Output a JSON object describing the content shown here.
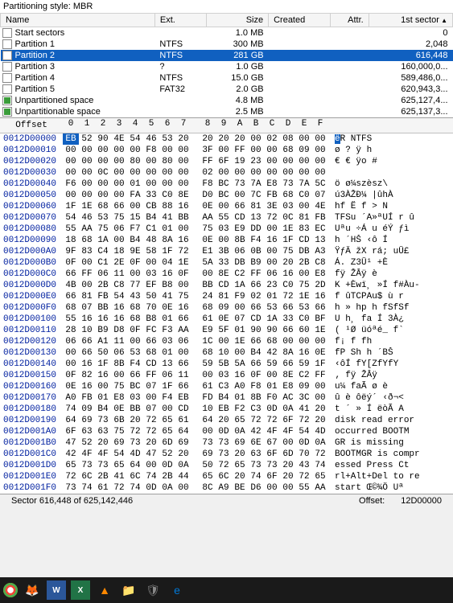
{
  "partitionStyleLabel": "Partitioning style: MBR",
  "columns": {
    "name": "Name",
    "ext": "Ext.",
    "size": "Size",
    "created": "Created",
    "attr": "Attr.",
    "firstSector": "1st sector"
  },
  "partitions": [
    {
      "name": "Start sectors",
      "ext": "",
      "size": "1.0 MB",
      "created": "",
      "attr": "",
      "first": "0",
      "icon": "plain"
    },
    {
      "name": "Partition 1",
      "ext": "NTFS",
      "size": "300 MB",
      "created": "",
      "attr": "",
      "first": "2,048",
      "icon": "plain"
    },
    {
      "name": "Partition 2",
      "ext": "NTFS",
      "size": "281 GB",
      "created": "",
      "attr": "",
      "first": "616,448",
      "icon": "plain",
      "selected": true
    },
    {
      "name": "Partition 3",
      "ext": "?",
      "size": "1.0 GB",
      "created": "",
      "attr": "",
      "first": "160,000,0...",
      "icon": "plain"
    },
    {
      "name": "Partition 4",
      "ext": "NTFS",
      "size": "15.0 GB",
      "created": "",
      "attr": "",
      "first": "589,486,0...",
      "icon": "plain"
    },
    {
      "name": "Partition 5",
      "ext": "FAT32",
      "size": "2.0 GB",
      "created": "",
      "attr": "",
      "first": "620,943,3...",
      "icon": "plain"
    },
    {
      "name": "Unpartitioned space",
      "ext": "",
      "size": "4.8 MB",
      "created": "",
      "attr": "",
      "first": "625,127,4...",
      "icon": "green"
    },
    {
      "name": "Unpartitionable space",
      "ext": "",
      "size": "2.5 MB",
      "created": "",
      "attr": "",
      "first": "625,137,3...",
      "icon": "green"
    }
  ],
  "hexHeader": {
    "offset": "Offset",
    "cols": [
      "0",
      "1",
      "2",
      "3",
      "4",
      "5",
      "6",
      "7",
      "8",
      "9",
      "A",
      "B",
      "C",
      "D",
      "E",
      "F"
    ]
  },
  "hexRows": [
    {
      "off": "0012D00000",
      "b": [
        "EB",
        "52",
        "90",
        "4E",
        "54",
        "46",
        "53",
        "20",
        "20",
        "20",
        "20",
        "00",
        "02",
        "08",
        "00",
        "00"
      ],
      "a": "ëR NTFS         ",
      "sel": 0
    },
    {
      "off": "0012D00010",
      "b": [
        "00",
        "00",
        "00",
        "00",
        "00",
        "F8",
        "00",
        "00",
        "3F",
        "00",
        "FF",
        "00",
        "00",
        "68",
        "09",
        "00"
      ],
      "a": "     ø  ? ÿ  h  "
    },
    {
      "off": "0012D00020",
      "b": [
        "00",
        "00",
        "00",
        "00",
        "80",
        "00",
        "80",
        "00",
        "FF",
        "6F",
        "19",
        "23",
        "00",
        "00",
        "00",
        "00"
      ],
      "a": "    €  € ÿo #    "
    },
    {
      "off": "0012D00030",
      "b": [
        "00",
        "00",
        "0C",
        "00",
        "00",
        "00",
        "00",
        "00",
        "02",
        "00",
        "00",
        "00",
        "00",
        "00",
        "00",
        "00"
      ],
      "a": "                "
    },
    {
      "off": "0012D00040",
      "b": [
        "F6",
        "00",
        "00",
        "00",
        "01",
        "00",
        "00",
        "00",
        "F8",
        "BC",
        "73",
        "7A",
        "E8",
        "73",
        "7A",
        "5C"
      ],
      "a": "ö       ø¼szèsz\\"
    },
    {
      "off": "0012D00050",
      "b": [
        "00",
        "00",
        "00",
        "00",
        "FA",
        "33",
        "C0",
        "8E",
        "D0",
        "BC",
        "00",
        "7C",
        "FB",
        "68",
        "C0",
        "07"
      ],
      "a": "    ú3ÀŽĐ¼ |ûhÀ "
    },
    {
      "off": "0012D00060",
      "b": [
        "1F",
        "1E",
        "68",
        "66",
        "00",
        "CB",
        "88",
        "16",
        "0E",
        "00",
        "66",
        "81",
        "3E",
        "03",
        "00",
        "4E"
      ],
      "a": "  hf Ë    f > N"
    },
    {
      "off": "0012D00070",
      "b": [
        "54",
        "46",
        "53",
        "75",
        "15",
        "B4",
        "41",
        "BB",
        "AA",
        "55",
        "CD",
        "13",
        "72",
        "0C",
        "81",
        "FB"
      ],
      "a": "TFSu ´A»ªUÍ r  û"
    },
    {
      "off": "0012D00080",
      "b": [
        "55",
        "AA",
        "75",
        "06",
        "F7",
        "C1",
        "01",
        "00",
        "75",
        "03",
        "E9",
        "DD",
        "00",
        "1E",
        "83",
        "EC"
      ],
      "a": "Uªu ÷Á  u éÝ  ƒì"
    },
    {
      "off": "0012D00090",
      "b": [
        "18",
        "68",
        "1A",
        "00",
        "B4",
        "48",
        "8A",
        "16",
        "0E",
        "00",
        "8B",
        "F4",
        "16",
        "1F",
        "CD",
        "13"
      ],
      "a": " h  ´HŠ   ‹ô  Í "
    },
    {
      "off": "0012D000A0",
      "b": [
        "9F",
        "83",
        "C4",
        "18",
        "9E",
        "58",
        "1F",
        "72",
        "E1",
        "3B",
        "06",
        "0B",
        "00",
        "75",
        "DB",
        "A3"
      ],
      "a": "ŸƒÄ žX rá;   uÛ£"
    },
    {
      "off": "0012D000B0",
      "b": [
        "0F",
        "00",
        "C1",
        "2E",
        "0F",
        "00",
        "04",
        "1E",
        "5A",
        "33",
        "DB",
        "B9",
        "00",
        "20",
        "2B",
        "C8"
      ],
      "a": "  Á.    Z3Û¹  +È"
    },
    {
      "off": "0012D000C0",
      "b": [
        "66",
        "FF",
        "06",
        "11",
        "00",
        "03",
        "16",
        "0F",
        "00",
        "8E",
        "C2",
        "FF",
        "06",
        "16",
        "00",
        "E8"
      ],
      "a": "fÿ      ŽÂÿ    è"
    },
    {
      "off": "0012D000D0",
      "b": [
        "4B",
        "00",
        "2B",
        "C8",
        "77",
        "EF",
        "B8",
        "00",
        "BB",
        "CD",
        "1A",
        "66",
        "23",
        "C0",
        "75",
        "2D"
      ],
      "a": "K +Èwï¸ »Í f#Àu-"
    },
    {
      "off": "0012D000E0",
      "b": [
        "66",
        "81",
        "FB",
        "54",
        "43",
        "50",
        "41",
        "75",
        "24",
        "81",
        "F9",
        "02",
        "01",
        "72",
        "1E",
        "16"
      ],
      "a": "f ûTCPAu$ ù  r  "
    },
    {
      "off": "0012D000F0",
      "b": [
        "68",
        "07",
        "BB",
        "16",
        "68",
        "70",
        "0E",
        "16",
        "68",
        "09",
        "00",
        "66",
        "53",
        "66",
        "53",
        "66"
      ],
      "a": "h » hp  h  fSfSf"
    },
    {
      "off": "0012D00100",
      "b": [
        "55",
        "16",
        "16",
        "16",
        "68",
        "B8",
        "01",
        "66",
        "61",
        "0E",
        "07",
        "CD",
        "1A",
        "33",
        "C0",
        "BF"
      ],
      "a": "U   h¸ fa  Í 3À¿"
    },
    {
      "off": "0012D00110",
      "b": [
        "28",
        "10",
        "B9",
        "D8",
        "0F",
        "FC",
        "F3",
        "AA",
        "E9",
        "5F",
        "01",
        "90",
        "90",
        "66",
        "60",
        "1E"
      ],
      "a": "( ¹Ø üóªé_  f` "
    },
    {
      "off": "0012D00120",
      "b": [
        "06",
        "66",
        "A1",
        "11",
        "00",
        "66",
        "03",
        "06",
        "1C",
        "00",
        "1E",
        "66",
        "68",
        "00",
        "00",
        "00"
      ],
      "a": " f¡  f    fh   "
    },
    {
      "off": "0012D00130",
      "b": [
        "00",
        "66",
        "50",
        "06",
        "53",
        "68",
        "01",
        "00",
        "68",
        "10",
        "00",
        "B4",
        "42",
        "8A",
        "16",
        "0E"
      ],
      "a": " fP Sh  h  ´BŠ  "
    },
    {
      "off": "0012D00140",
      "b": [
        "00",
        "16",
        "1F",
        "8B",
        "F4",
        "CD",
        "13",
        "66",
        "59",
        "5B",
        "5A",
        "66",
        "59",
        "66",
        "59",
        "1F"
      ],
      "a": "   ‹ôÍ fY[ZfYfY "
    },
    {
      "off": "0012D00150",
      "b": [
        "0F",
        "82",
        "16",
        "00",
        "66",
        "FF",
        "06",
        "11",
        "00",
        "03",
        "16",
        "0F",
        "00",
        "8E",
        "C2",
        "FF"
      ],
      "a": " ‚  fÿ      ŽÂÿ"
    },
    {
      "off": "0012D00160",
      "b": [
        "0E",
        "16",
        "00",
        "75",
        "BC",
        "07",
        "1F",
        "66",
        "61",
        "C3",
        "A0",
        "F8",
        "01",
        "E8",
        "09",
        "00"
      ],
      "a": "   u¼  faÃ ø è  "
    },
    {
      "off": "0012D00170",
      "b": [
        "A0",
        "FB",
        "01",
        "E8",
        "03",
        "00",
        "F4",
        "EB",
        "FD",
        "B4",
        "01",
        "8B",
        "F0",
        "AC",
        "3C",
        "00"
      ],
      "a": " û è  ôëý´ ‹ð¬< "
    },
    {
      "off": "0012D00180",
      "b": [
        "74",
        "09",
        "B4",
        "0E",
        "BB",
        "07",
        "00",
        "CD",
        "10",
        "EB",
        "F2",
        "C3",
        "0D",
        "0A",
        "41",
        "20"
      ],
      "a": "t ´ »  Í ëòÃ  A "
    },
    {
      "off": "0012D00190",
      "b": [
        "64",
        "69",
        "73",
        "6B",
        "20",
        "72",
        "65",
        "61",
        "64",
        "20",
        "65",
        "72",
        "72",
        "6F",
        "72",
        "20"
      ],
      "a": "disk read error "
    },
    {
      "off": "0012D001A0",
      "b": [
        "6F",
        "63",
        "63",
        "75",
        "72",
        "72",
        "65",
        "64",
        "00",
        "0D",
        "0A",
        "42",
        "4F",
        "4F",
        "54",
        "4D"
      ],
      "a": "occurred   BOOTM"
    },
    {
      "off": "0012D001B0",
      "b": [
        "47",
        "52",
        "20",
        "69",
        "73",
        "20",
        "6D",
        "69",
        "73",
        "73",
        "69",
        "6E",
        "67",
        "00",
        "0D",
        "0A"
      ],
      "a": "GR is missing   "
    },
    {
      "off": "0012D001C0",
      "b": [
        "42",
        "4F",
        "4F",
        "54",
        "4D",
        "47",
        "52",
        "20",
        "69",
        "73",
        "20",
        "63",
        "6F",
        "6D",
        "70",
        "72"
      ],
      "a": "BOOTMGR is compr"
    },
    {
      "off": "0012D001D0",
      "b": [
        "65",
        "73",
        "73",
        "65",
        "64",
        "00",
        "0D",
        "0A",
        "50",
        "72",
        "65",
        "73",
        "73",
        "20",
        "43",
        "74"
      ],
      "a": "essed   Press Ct"
    },
    {
      "off": "0012D001E0",
      "b": [
        "72",
        "6C",
        "2B",
        "41",
        "6C",
        "74",
        "2B",
        "44",
        "65",
        "6C",
        "20",
        "74",
        "6F",
        "20",
        "72",
        "65"
      ],
      "a": "rl+Alt+Del to re"
    },
    {
      "off": "0012D001F0",
      "b": [
        "73",
        "74",
        "61",
        "72",
        "74",
        "0D",
        "0A",
        "00",
        "8C",
        "A9",
        "BE",
        "D6",
        "00",
        "00",
        "55",
        "AA"
      ],
      "a": "start   Œ©¾Ö  Uª"
    }
  ],
  "status": {
    "sector": "Sector 616,448 of 625,142,446",
    "offsetLabel": "Offset:",
    "offsetValue": "12D00000"
  },
  "taskbarIcons": [
    "chrome",
    "firefox",
    "word",
    "excel",
    "vlc",
    "folder",
    "shield",
    "edge"
  ]
}
